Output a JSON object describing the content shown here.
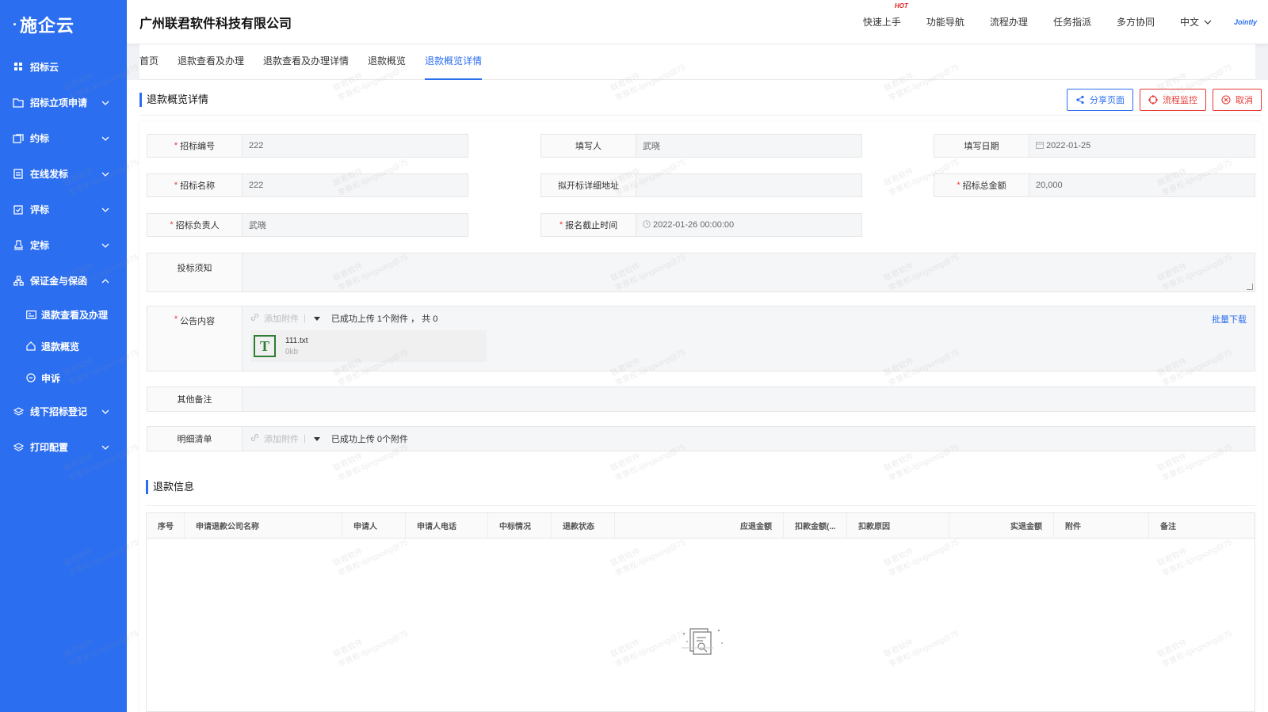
{
  "sidebar": {
    "logo": "施企云",
    "items": [
      {
        "label": "招标云",
        "icon": "grid-icon"
      },
      {
        "label": "招标立项申请",
        "icon": "folder-icon",
        "chev": "down"
      },
      {
        "label": "约标",
        "icon": "stack-icon",
        "chev": "down"
      },
      {
        "label": "在线发标",
        "icon": "document-icon",
        "chev": "down"
      },
      {
        "label": "评标",
        "icon": "clipboard-icon",
        "chev": "down"
      },
      {
        "label": "定标",
        "icon": "stamp-icon",
        "chev": "down"
      },
      {
        "label": "保证金与保函",
        "icon": "org-icon",
        "chev": "up"
      }
    ],
    "sub_items": [
      {
        "label": "退款查看及办理",
        "icon": "card-icon"
      },
      {
        "label": "退款概览",
        "icon": "home-icon"
      },
      {
        "label": "申诉",
        "icon": "badge-icon"
      }
    ],
    "items_after": [
      {
        "label": "线下招标登记",
        "icon": "layers-icon",
        "chev": "down"
      },
      {
        "label": "打印配置",
        "icon": "layers-icon",
        "chev": "down"
      }
    ]
  },
  "header": {
    "company": "广州联君软件科技有限公司",
    "nav": [
      "快速上手",
      "功能导航",
      "流程办理",
      "任务指派",
      "多方协同"
    ],
    "hot_badge": "HOT",
    "language": "中文",
    "brand": "Jointly"
  },
  "tabs": [
    "首页",
    "退款查看及办理",
    "退款查看及办理详情",
    "退款概览",
    "退款概览详情"
  ],
  "active_tab": 4,
  "page": {
    "title": "退款概览详情",
    "buttons": {
      "share": "分享页面",
      "monitor": "流程监控",
      "cancel": "取消"
    }
  },
  "form": {
    "bid_no": {
      "label": "招标编号",
      "value": "222"
    },
    "writer": {
      "label": "填写人",
      "value": "武晓"
    },
    "fill_date": {
      "label": "填写日期",
      "value": "2022-01-25"
    },
    "bid_name": {
      "label": "招标名称",
      "value": "222"
    },
    "open_addr": {
      "label": "拟开标详细地址",
      "value": ""
    },
    "total_amount": {
      "label": "招标总金额",
      "value": "20,000"
    },
    "owner": {
      "label": "招标负责人",
      "value": "武晓"
    },
    "deadline": {
      "label": "报名截止时间",
      "value": "2022-01-26 00:00:00"
    },
    "notice": {
      "label": "投标须知"
    },
    "announcement": {
      "label": "公告内容",
      "add_attachment": "添加附件",
      "status": "已成功上传 1个附件 ， 共 0",
      "batch_download": "批量下载",
      "file_name": "111.txt",
      "file_size": "0kb",
      "file_icon_letter": "T"
    },
    "other_remarks": {
      "label": "其他备注"
    },
    "detail_list": {
      "label": "明细清单",
      "add_attachment": "添加附件",
      "status": "已成功上传 0个附件"
    }
  },
  "refund_section": {
    "title": "退款信息",
    "columns": [
      "序号",
      "申请退款公司名称",
      "申请人",
      "申请人电话",
      "中标情况",
      "退款状态",
      "应退金额",
      "扣款金额(...",
      "扣款原因",
      "实退金额",
      "附件",
      "备注"
    ]
  },
  "watermark": {
    "line1": "联君软件",
    "line2": "李景松-lijingsong@75"
  },
  "colors": {
    "primary": "#2b6ef0",
    "danger": "#e53935",
    "sidebar": "#2b6ef0"
  }
}
